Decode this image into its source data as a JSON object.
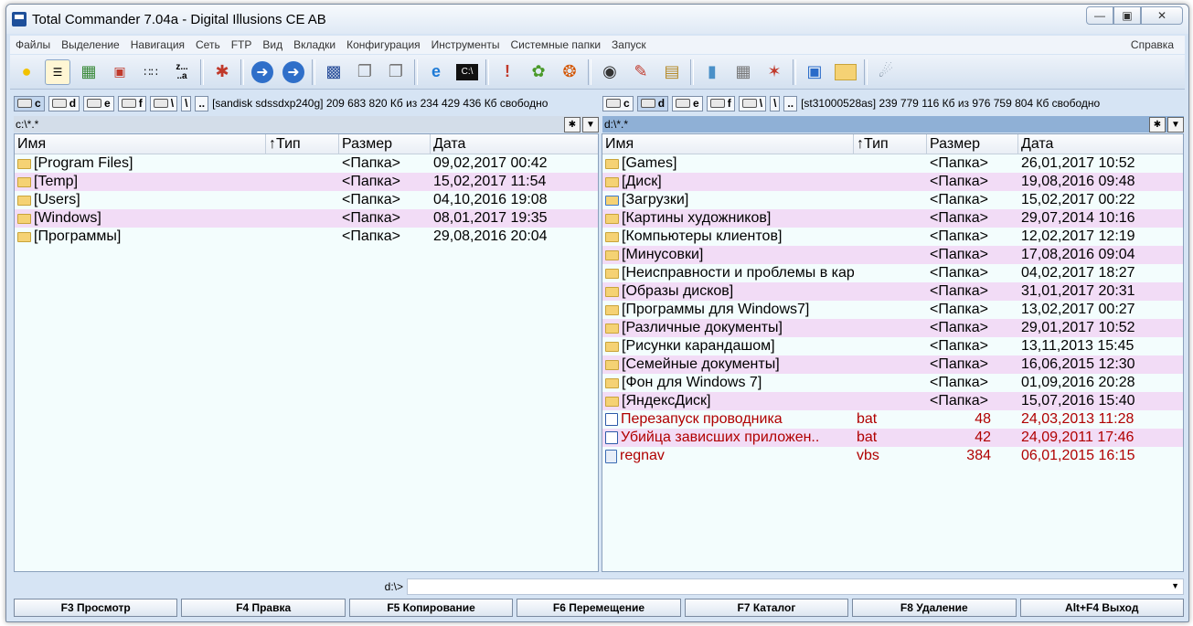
{
  "window": {
    "title": "Total Commander 7.04a - Digital Illusions CE AB"
  },
  "menu": {
    "items": [
      "Файлы",
      "Выделение",
      "Навигация",
      "Сеть",
      "FTP",
      "Вид",
      "Вкладки",
      "Конфигурация",
      "Инструменты",
      "Системные папки",
      "Запуск"
    ],
    "help": "Справка"
  },
  "toolbar": {
    "sort_label": "z...\n..a"
  },
  "left": {
    "drives": [
      "c",
      "d",
      "e",
      "f",
      "\\",
      ".."
    ],
    "active_drive": "c",
    "drive_info": "[sandisk sdssdxp240g]  209 683 820 Кб из 234 429 436 Кб свободно",
    "path": "c:\\*.*",
    "columns": {
      "name": "Имя",
      "ext": "↑Тип",
      "size": "Размер",
      "date": "Дата"
    },
    "rows": [
      {
        "name": "[Program Files]",
        "ext": "",
        "size": "<Папка>",
        "date": "09,02,2017 00:42"
      },
      {
        "name": "[Temp]",
        "ext": "",
        "size": "<Папка>",
        "date": "15,02,2017 11:54"
      },
      {
        "name": "[Users]",
        "ext": "",
        "size": "<Папка>",
        "date": "04,10,2016 19:08"
      },
      {
        "name": "[Windows]",
        "ext": "",
        "size": "<Папка>",
        "date": "08,01,2017 19:35"
      },
      {
        "name": "[Программы]",
        "ext": "",
        "size": "<Папка>",
        "date": "29,08,2016 20:04"
      }
    ]
  },
  "right": {
    "drives": [
      "c",
      "d",
      "e",
      "f",
      "\\",
      ".."
    ],
    "active_drive": "d",
    "drive_info": "[st31000528as]  239 779 116 Кб из 976 759 804 Кб свободно",
    "path": "d:\\*.*",
    "columns": {
      "name": "Имя",
      "ext": "↑Тип",
      "size": "Размер",
      "date": "Дата"
    },
    "rows": [
      {
        "name": "[Games]",
        "ext": "",
        "size": "<Папка>",
        "date": "26,01,2017 10:52",
        "icon": "folder"
      },
      {
        "name": "[Диск]",
        "ext": "",
        "size": "<Папка>",
        "date": "19,08,2016 09:48",
        "icon": "folder"
      },
      {
        "name": "[Загрузки]",
        "ext": "",
        "size": "<Папка>",
        "date": "15,02,2017 00:22",
        "icon": "download-folder"
      },
      {
        "name": "[Картины художников]",
        "ext": "",
        "size": "<Папка>",
        "date": "29,07,2014 10:16",
        "icon": "folder"
      },
      {
        "name": "[Компьютеры клиентов]",
        "ext": "",
        "size": "<Папка>",
        "date": "12,02,2017 12:19",
        "icon": "folder"
      },
      {
        "name": "[Минусовки]",
        "ext": "",
        "size": "<Папка>",
        "date": "17,08,2016 09:04",
        "icon": "folder"
      },
      {
        "name": "[Неисправности и проблемы в карти..]",
        "ext": "",
        "size": "<Папка>",
        "date": "04,02,2017 18:27",
        "icon": "folder"
      },
      {
        "name": "[Образы дисков]",
        "ext": "",
        "size": "<Папка>",
        "date": "31,01,2017 20:31",
        "icon": "folder"
      },
      {
        "name": "[Программы для Windows7]",
        "ext": "",
        "size": "<Папка>",
        "date": "13,02,2017 00:27",
        "icon": "folder"
      },
      {
        "name": "[Различные документы]",
        "ext": "",
        "size": "<Папка>",
        "date": "29,01,2017 10:52",
        "icon": "folder"
      },
      {
        "name": "[Рисунки карандашом]",
        "ext": "",
        "size": "<Папка>",
        "date": "13,11,2013 15:45",
        "icon": "folder"
      },
      {
        "name": "[Семейные документы]",
        "ext": "",
        "size": "<Папка>",
        "date": "16,06,2015 12:30",
        "icon": "folder"
      },
      {
        "name": "[Фон для Windows 7]",
        "ext": "",
        "size": "<Папка>",
        "date": "01,09,2016 20:28",
        "icon": "folder"
      },
      {
        "name": "[ЯндексДиск]",
        "ext": "",
        "size": "<Папка>",
        "date": "15,07,2016 15:40",
        "icon": "folder"
      },
      {
        "name": "Перезапуск проводника",
        "ext": "bat",
        "size": "48",
        "date": "24,03,2013 11:28",
        "icon": "bat-file",
        "color": "#b00000"
      },
      {
        "name": "Убийца зависших приложен..",
        "ext": "bat",
        "size": "42",
        "date": "24,09,2011 17:46",
        "icon": "bat-file",
        "color": "#b00000"
      },
      {
        "name": "regnav",
        "ext": "vbs",
        "size": "384",
        "date": "06,01,2015 16:15",
        "icon": "vbs-file",
        "color": "#b00000"
      }
    ]
  },
  "cmdline": {
    "prompt": "d:\\>",
    "value": ""
  },
  "fkeys": [
    "F3 Просмотр",
    "F4 Правка",
    "F5 Копирование",
    "F6 Перемещение",
    "F7 Каталог",
    "F8 Удаление",
    "Alt+F4 Выход"
  ]
}
